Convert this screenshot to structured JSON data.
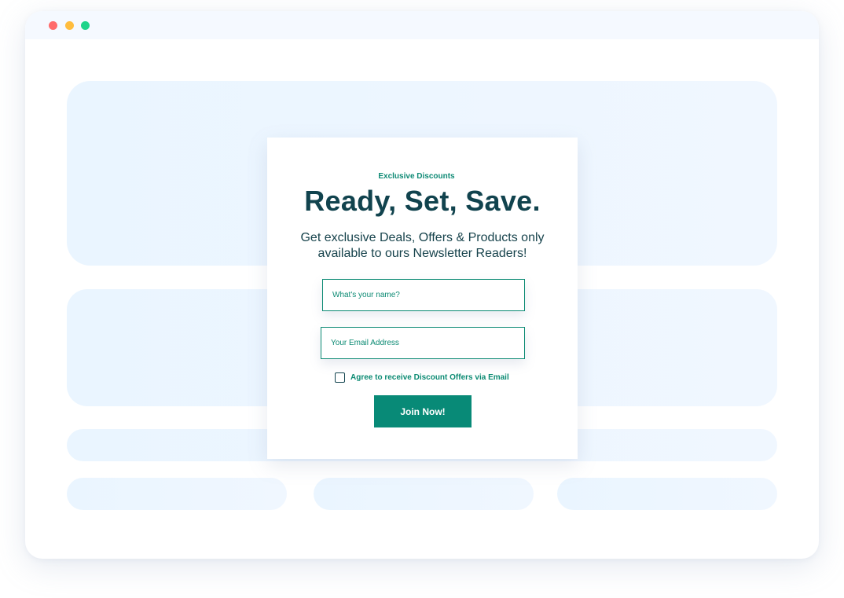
{
  "popup": {
    "eyebrow": "Exclusive Discounts",
    "headline": "Ready, Set, Save.",
    "subtext": "Get exclusive Deals, Offers & Products only available to ours Newsletter Readers!",
    "name_placeholder": "What's your name?",
    "email_placeholder": "Your Email Address",
    "agree_label": "Agree to receive Discount Offers via Email",
    "agree_checked": false,
    "join_label": "Join Now!"
  },
  "colors": {
    "accent": "#088a77",
    "heading": "#11434e",
    "placeholder_bg": "#eaf5ff",
    "dot_red": "#ff6b6b",
    "dot_yellow": "#ffbd3e",
    "dot_green": "#1ed48a"
  }
}
